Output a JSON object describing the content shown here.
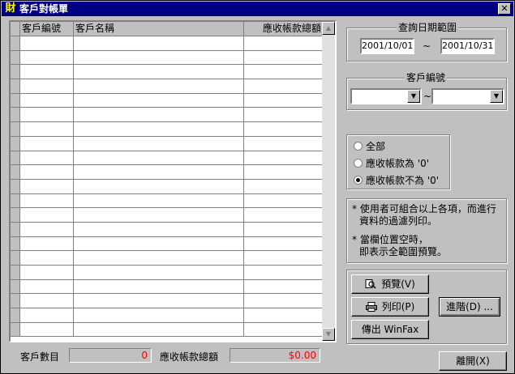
{
  "window": {
    "app_icon": "財",
    "title": "客戶對帳單",
    "close_glyph": "✕"
  },
  "grid": {
    "columns": [
      "客戶編號",
      "客戶名稱",
      "應收帳款總額"
    ],
    "row_count": 21
  },
  "footer": {
    "count_label": "客戶數目",
    "count_value": "0",
    "total_label": "應收帳款總額",
    "total_value": "$0.00"
  },
  "date_range": {
    "title": "查詢日期範圍",
    "from": "2001/10/01",
    "separator": "~",
    "to": "2001/10/31"
  },
  "customer_range": {
    "title": "客戶編號",
    "from": "",
    "separator": "~",
    "to": ""
  },
  "filter": {
    "options": [
      "全部",
      "應收帳款為 '0'",
      "應收帳款不為 '0'"
    ],
    "selected_index": 2
  },
  "notes": {
    "line1": "* 使用者可組合以上各項，而進行",
    "line2": "資料的過濾列印。",
    "line3": "* 當欄位置空時，",
    "line4": "即表示全範圍預覽。"
  },
  "buttons": {
    "preview": "預覽(V)",
    "print": "列印(P)",
    "winfax": "傳出 WinFax",
    "advanced": "進階(D) ...",
    "exit": "離開(X)"
  },
  "icons": {
    "preview_icon": "magnifier-document-icon",
    "print_icon": "printer-icon"
  }
}
